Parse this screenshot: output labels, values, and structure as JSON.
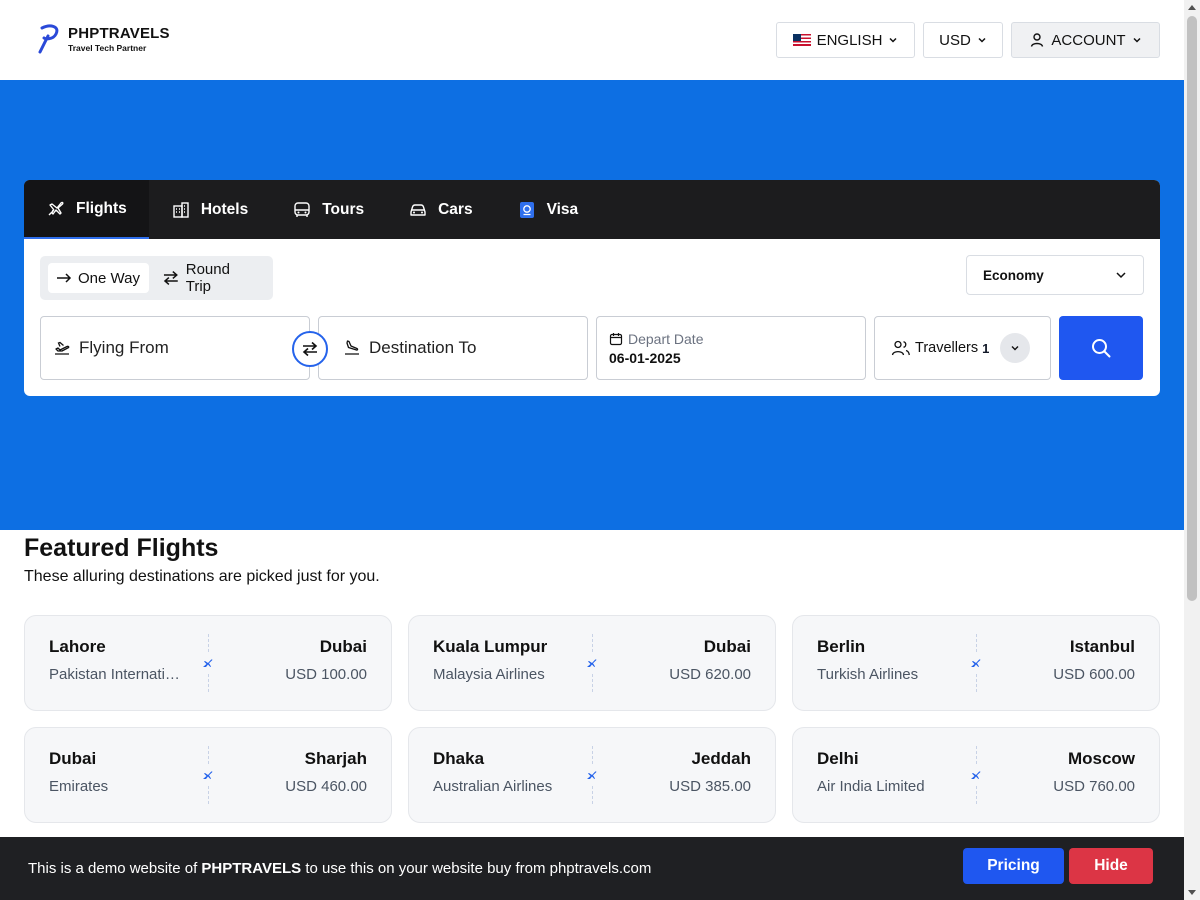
{
  "header": {
    "logo_title": "PHPTRAVELS",
    "logo_subtitle": "Travel Tech Partner",
    "language": "ENGLISH",
    "currency": "USD",
    "account": "ACCOUNT"
  },
  "search": {
    "tabs": [
      {
        "label": "Flights",
        "icon": "plane-icon",
        "active": true
      },
      {
        "label": "Hotels",
        "icon": "building-icon"
      },
      {
        "label": "Tours",
        "icon": "bus-icon"
      },
      {
        "label": "Cars",
        "icon": "car-icon"
      },
      {
        "label": "Visa",
        "icon": "passport-icon"
      }
    ],
    "trip_types": {
      "one_way": "One Way",
      "round_trip": "Round Trip"
    },
    "cabin_class": "Economy",
    "from_placeholder": "Flying From",
    "to_placeholder": "Destination To",
    "depart_label": "Depart Date",
    "depart_value": "06-01-2025",
    "travellers_label": "Travellers",
    "travellers_count": "1"
  },
  "featured": {
    "title": "Featured Flights",
    "subtitle": "These alluring destinations are picked just for you.",
    "flights": [
      {
        "from": "Lahore",
        "airline": "Pakistan International Airlines",
        "to": "Dubai",
        "price": "USD 100.00"
      },
      {
        "from": "Kuala Lumpur",
        "airline": "Malaysia Airlines",
        "to": "Dubai",
        "price": "USD 620.00"
      },
      {
        "from": "Berlin",
        "airline": "Turkish Airlines",
        "to": "Istanbul",
        "price": "USD 600.00"
      },
      {
        "from": "Dubai",
        "airline": "Emirates",
        "to": "Sharjah",
        "price": "USD 460.00"
      },
      {
        "from": "Dhaka",
        "airline": "Australian Airlines",
        "to": "Jeddah",
        "price": "USD 385.00"
      },
      {
        "from": "Delhi",
        "airline": "Air India Limited",
        "to": "Moscow",
        "price": "USD 760.00"
      }
    ]
  },
  "demo_bar": {
    "text_prefix": "This is a demo website of",
    "brand": "PHPTRAVELS",
    "text_suffix": "to use this on your website buy from phptravels.com",
    "pricing": "Pricing",
    "hide": "Hide"
  },
  "colors": {
    "hero": "#0d6fe3",
    "primary": "#1f57f0",
    "danger": "#dc3545",
    "dark": "#1c1c1e"
  }
}
